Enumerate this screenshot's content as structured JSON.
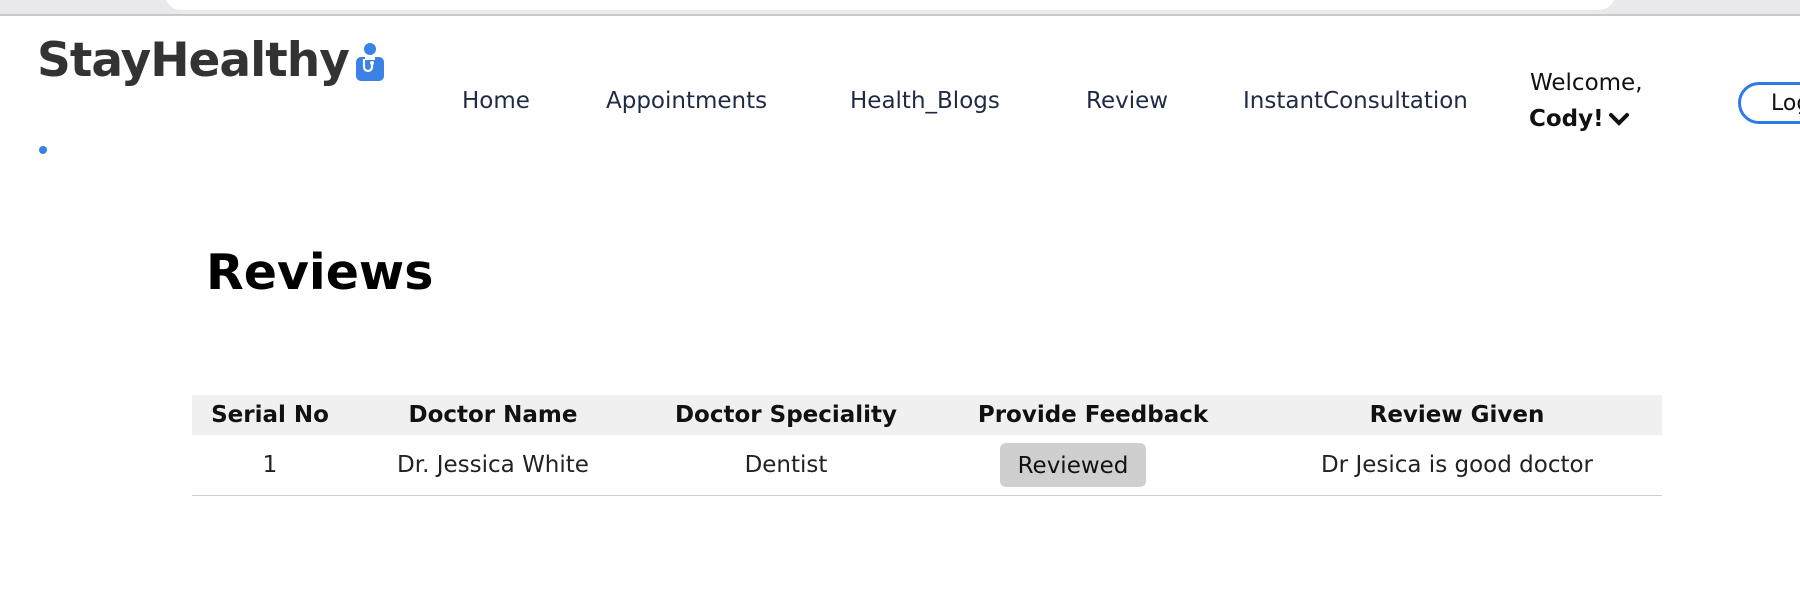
{
  "brand": {
    "name": "StayHealthy",
    "accent_color": "#3b82e6",
    "icon": "doctor-icon"
  },
  "nav": {
    "links": [
      "Home",
      "Appointments",
      "Health_Blogs",
      "Review",
      "InstantConsultation"
    ],
    "welcome": "Welcome,",
    "user": "Cody!",
    "user_menu_icon": "chevron-down-icon",
    "logout_label": "Log"
  },
  "page": {
    "title": "Reviews"
  },
  "table": {
    "headers": [
      "Serial No",
      "Doctor Name",
      "Doctor Speciality",
      "Provide Feedback",
      "Review Given"
    ],
    "rows": [
      {
        "serial": "1",
        "doctor_name": "Dr. Jessica White",
        "speciality": "Dentist",
        "feedback_button": "Reviewed",
        "review": "Dr Jesica is good doctor"
      }
    ]
  }
}
